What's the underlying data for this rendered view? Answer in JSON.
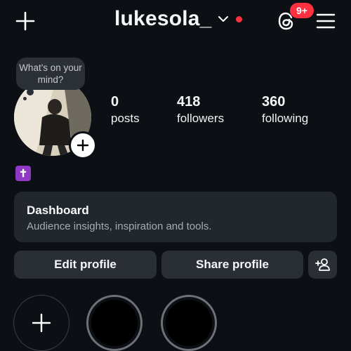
{
  "header": {
    "username": "lukesola_",
    "notification_badge": "9+",
    "colors": {
      "badge": "#ff3040",
      "live_dot": "#ff3040"
    },
    "icons": [
      "plus-icon",
      "chevron-down-icon",
      "threads-icon",
      "menu-icon"
    ]
  },
  "note": {
    "text": "What's on your mind?"
  },
  "stats": {
    "posts": {
      "value": "0",
      "label": "posts"
    },
    "followers": {
      "value": "418",
      "label": "followers"
    },
    "following": {
      "value": "360",
      "label": "following"
    }
  },
  "bio": {
    "emoji": "✝",
    "emoji_color": "#8e3ac4"
  },
  "dashboard": {
    "title": "Dashboard",
    "subtitle": "Audience insights, inspiration and tools."
  },
  "buttons": {
    "edit_profile": "Edit profile",
    "share_profile": "Share profile"
  },
  "highlights": [
    {
      "type": "new"
    },
    {
      "type": "highlight"
    },
    {
      "type": "highlight"
    }
  ]
}
